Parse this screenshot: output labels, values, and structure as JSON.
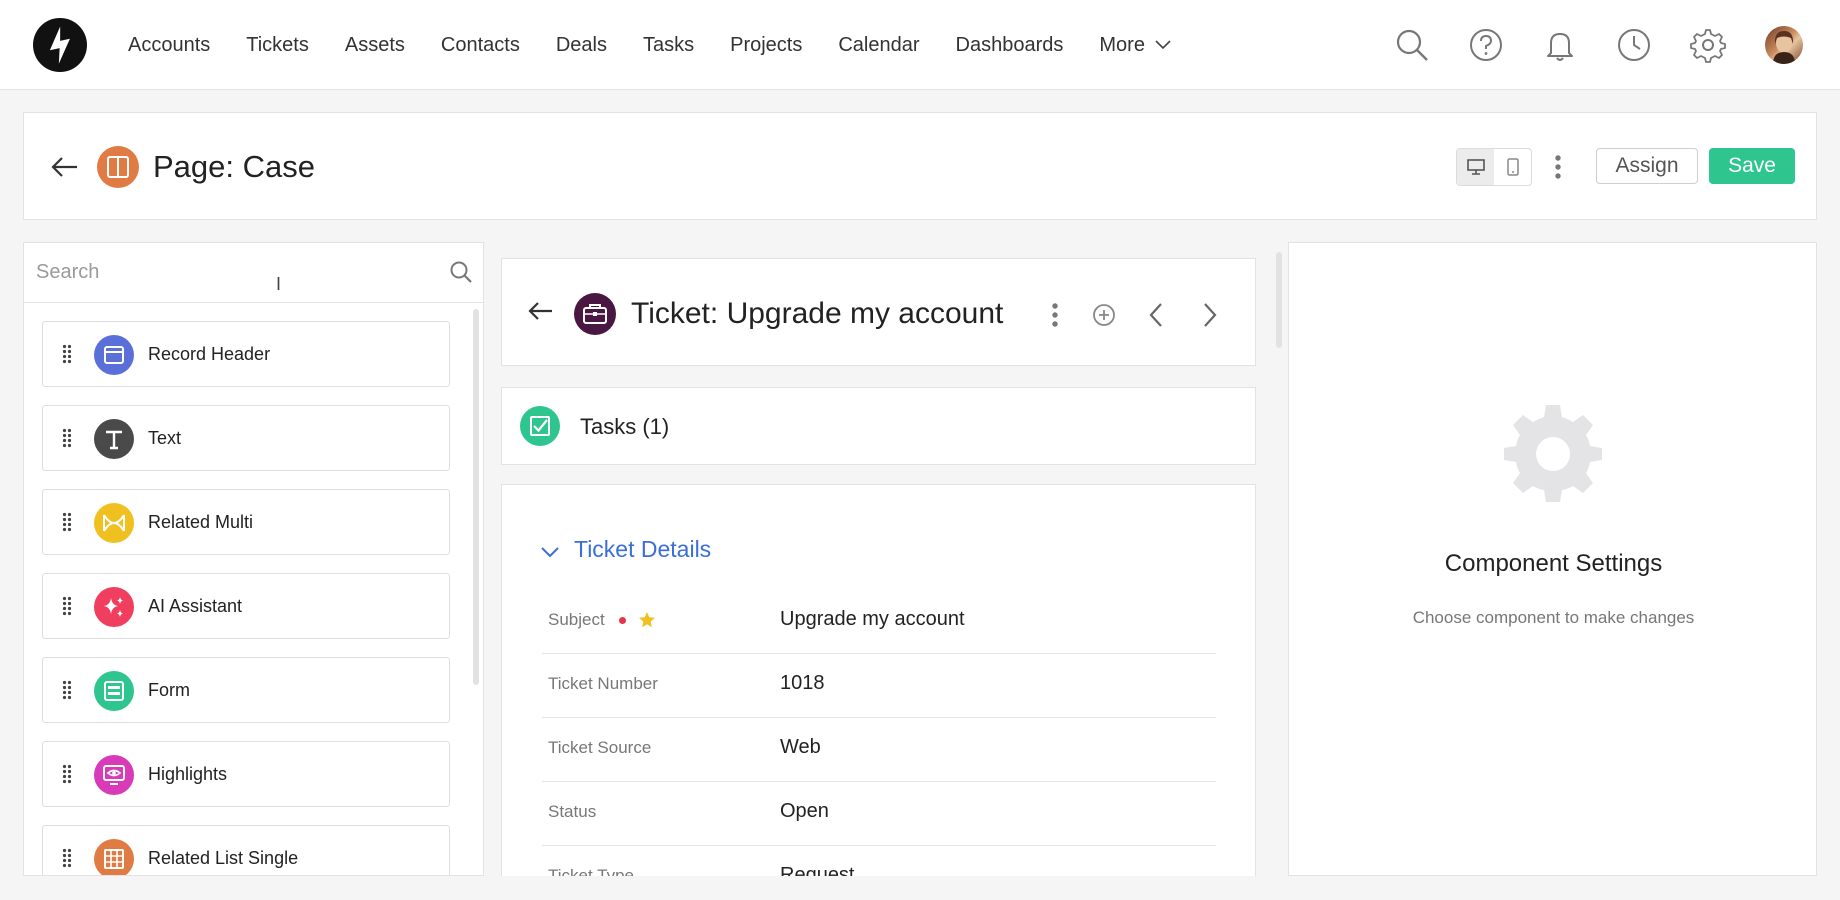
{
  "nav": {
    "links": [
      "Accounts",
      "Tickets",
      "Assets",
      "Contacts",
      "Deals",
      "Tasks",
      "Projects",
      "Calendar",
      "Dashboards"
    ],
    "more_label": "More",
    "icons": [
      "search-icon",
      "help-icon",
      "bell-icon",
      "clock-icon",
      "gear-icon"
    ]
  },
  "page": {
    "title": "Page: Case",
    "assign_label": "Assign",
    "save_label": "Save",
    "accent": "#2ec58e"
  },
  "left": {
    "search_placeholder": "Search",
    "components": [
      {
        "label": "Record Header",
        "color": "#5b6fd8",
        "icon": "record-header-icon"
      },
      {
        "label": "Text",
        "color": "#4a4a4a",
        "icon": "text-icon"
      },
      {
        "label": "Related Multi",
        "color": "#f0c020",
        "icon": "related-multi-icon"
      },
      {
        "label": "AI Assistant",
        "color": "#f03e5e",
        "icon": "sparkle-icon"
      },
      {
        "label": "Form",
        "color": "#2ec58e",
        "icon": "form-icon"
      },
      {
        "label": "Highlights",
        "color": "#d83ab8",
        "icon": "highlights-icon"
      },
      {
        "label": "Related List Single",
        "color": "#e07b43",
        "icon": "table-icon"
      }
    ]
  },
  "ticket": {
    "title": "Ticket: Upgrade my account",
    "tasks_label": "Tasks (1)",
    "details_title": "Ticket Details",
    "fields": [
      {
        "label": "Subject",
        "value": "Upgrade my account",
        "required": true
      },
      {
        "label": "Ticket Number",
        "value": "1018"
      },
      {
        "label": "Ticket Source",
        "value": "Web"
      },
      {
        "label": "Status",
        "value": "Open"
      },
      {
        "label": "Ticket Type",
        "value": "Request"
      }
    ]
  },
  "settings": {
    "title": "Component Settings",
    "subtitle": "Choose component to make changes"
  }
}
